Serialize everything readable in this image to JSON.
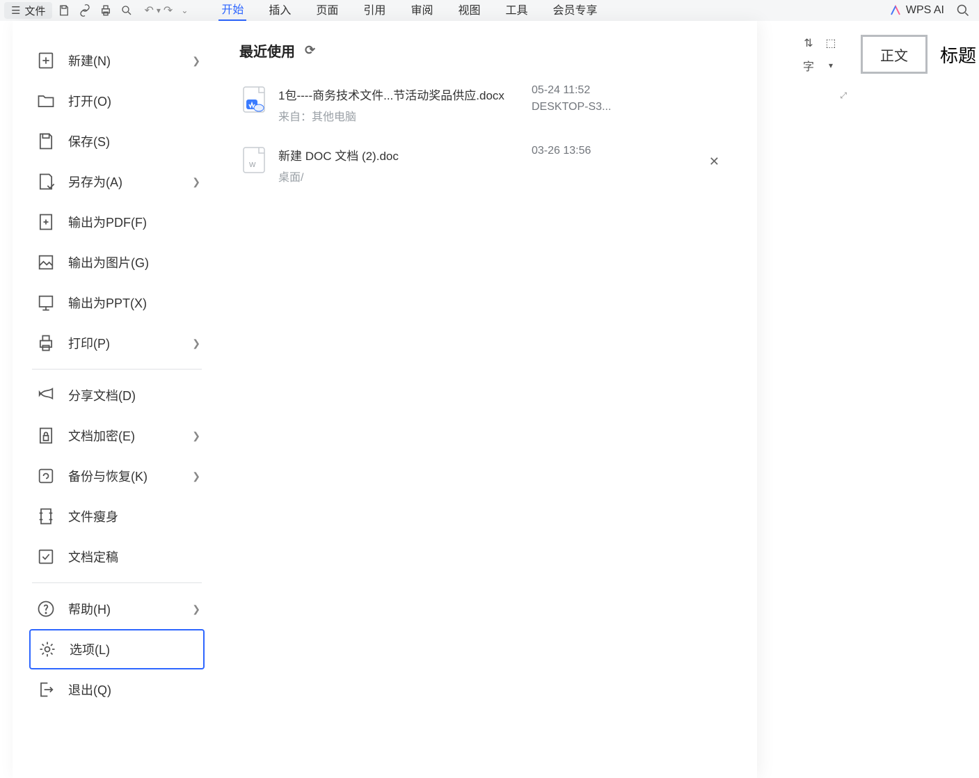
{
  "topbar": {
    "file_label": "文件",
    "tabs": [
      "开始",
      "插入",
      "页面",
      "引用",
      "审阅",
      "视图",
      "工具",
      "会员专享"
    ],
    "active_tab": 0,
    "ai_label": "WPS AI"
  },
  "styles": {
    "card": "正文",
    "label": "标题"
  },
  "sidebar": {
    "items": [
      {
        "id": "new",
        "label": "新建(N)",
        "chev": true
      },
      {
        "id": "open",
        "label": "打开(O)"
      },
      {
        "id": "save",
        "label": "保存(S)"
      },
      {
        "id": "saveas",
        "label": "另存为(A)",
        "chev": true
      },
      {
        "id": "pdf",
        "label": "输出为PDF(F)"
      },
      {
        "id": "img",
        "label": "输出为图片(G)"
      },
      {
        "id": "ppt",
        "label": "输出为PPT(X)"
      },
      {
        "id": "print",
        "label": "打印(P)",
        "chev": true
      },
      {
        "id": "share",
        "label": "分享文档(D)"
      },
      {
        "id": "encrypt",
        "label": "文档加密(E)",
        "chev": true
      },
      {
        "id": "backup",
        "label": "备份与恢复(K)",
        "chev": true
      },
      {
        "id": "slim",
        "label": "文件瘦身"
      },
      {
        "id": "final",
        "label": "文档定稿"
      },
      {
        "id": "help",
        "label": "帮助(H)",
        "chev": true
      },
      {
        "id": "options",
        "label": "选项(L)",
        "selected": true
      },
      {
        "id": "exit",
        "label": "退出(Q)"
      }
    ]
  },
  "content": {
    "recent_title": "最近使用",
    "files": [
      {
        "name": "1包----商务技术文件...节活动奖品供应.docx",
        "source": "来自：其他电脑",
        "time": "05-24 11:52",
        "device": "DESKTOP-S3...",
        "type": "docx-cloud"
      },
      {
        "name": "新建 DOC 文档 (2).doc",
        "source": "桌面/",
        "time": "03-26 13:56",
        "device": "",
        "type": "doc",
        "hover": true
      }
    ]
  }
}
